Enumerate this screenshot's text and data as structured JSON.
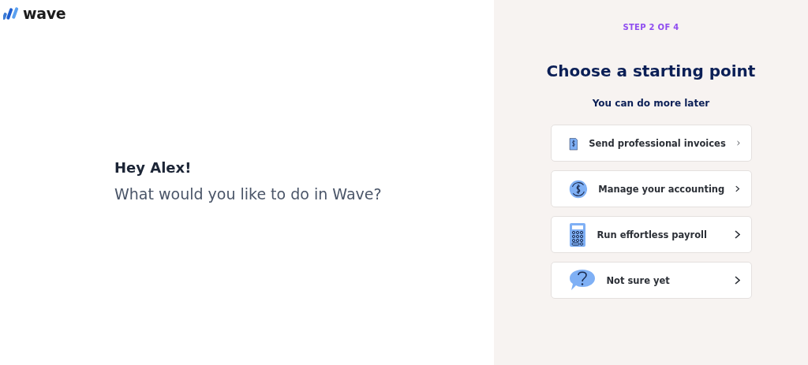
{
  "logo": {
    "text": "wave"
  },
  "greeting": {
    "title": "Hey Alex!",
    "question": "What would you like to do in Wave?"
  },
  "step": "STEP 2 OF 4",
  "heading": "Choose a starting point",
  "subheading": "You can do more later",
  "options": [
    {
      "kind": "invoices",
      "label": "Send professional invoices"
    },
    {
      "kind": "accounting",
      "label": "Manage your accounting"
    },
    {
      "kind": "payroll",
      "label": "Run effortless payroll"
    },
    {
      "kind": "unsure",
      "label": "Not sure yet"
    }
  ]
}
